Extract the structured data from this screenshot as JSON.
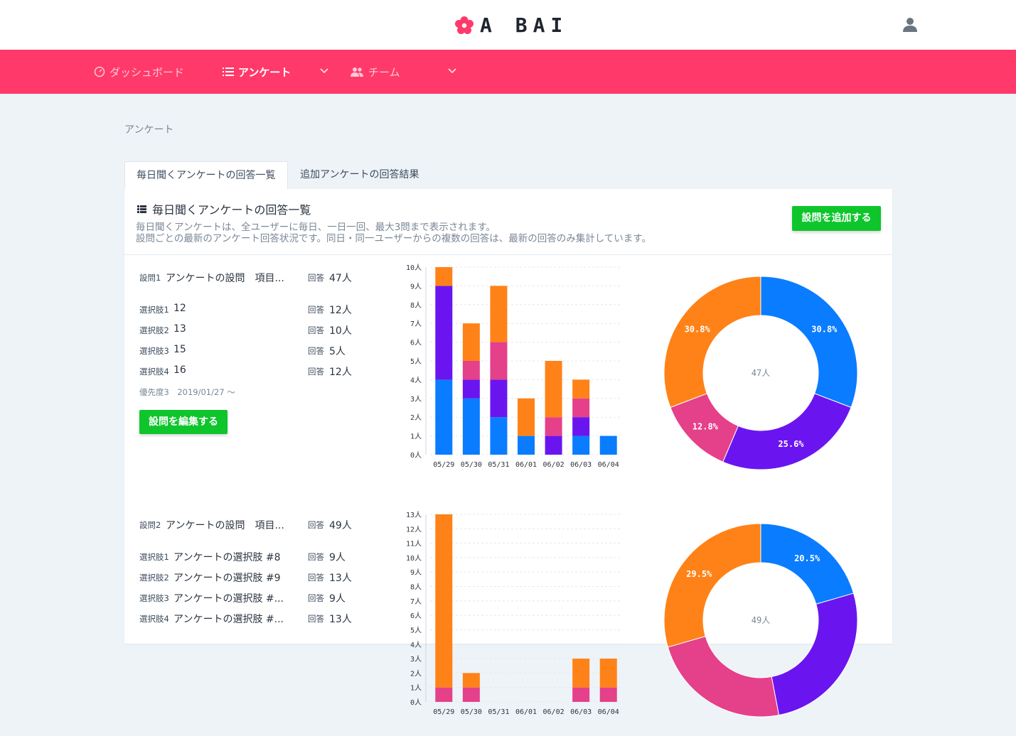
{
  "header": {
    "logo_text": "A BAI",
    "brand_color": "#ff3a6b"
  },
  "nav": {
    "dashboard": "ダッシュボード",
    "survey": "アンケート",
    "team": "チーム"
  },
  "breadcrumb": "アンケート",
  "tabs": [
    "毎日聞くアンケートの回答一覧",
    "追加アンケートの回答結果"
  ],
  "card": {
    "title": "毎日聞くアンケートの回答一覧",
    "desc1": "毎日聞くアンケートは、全ユーザーに毎日、一日一回、最大3問まで表示されます。",
    "desc2": "設問ごとの最新のアンケート回答状況です。同日・同一ユーザーからの複数の回答は、最新の回答のみ集計しています。",
    "add_button": "設問を追加する"
  },
  "labels": {
    "answer": "回答",
    "edit_button": "設問を編集する"
  },
  "colors": {
    "choice1": "#0a7cff",
    "choice2": "#6a15f0",
    "choice3": "#e5408a",
    "choice4": "#ff8218",
    "green": "#0ec52c"
  },
  "questions": [
    {
      "label": "設問1",
      "text": "アンケートの設問　項目...",
      "total": "47人",
      "choices": [
        {
          "label": "選択肢1",
          "text": "12",
          "count": "12人"
        },
        {
          "label": "選択肢2",
          "text": "13",
          "count": "10人"
        },
        {
          "label": "選択肢3",
          "text": "15",
          "count": "5人"
        },
        {
          "label": "選択肢4",
          "text": "16",
          "count": "12人"
        }
      ],
      "priority": "優先度3　2019/01/27 ～"
    },
    {
      "label": "設問2",
      "text": "アンケートの設問　項目...",
      "total": "49人",
      "choices": [
        {
          "label": "選択肢1",
          "text": "アンケートの選択肢 #8",
          "count": "9人"
        },
        {
          "label": "選択肢2",
          "text": "アンケートの選択肢 #9",
          "count": "13人"
        },
        {
          "label": "選択肢3",
          "text": "アンケートの選択肢 #...",
          "count": "9人"
        },
        {
          "label": "選択肢4",
          "text": "アンケートの選択肢 #...",
          "count": "13人"
        }
      ],
      "priority": ""
    }
  ],
  "chart_data": [
    {
      "type": "bar",
      "stacked": true,
      "categories": [
        "05/29",
        "05/30",
        "05/31",
        "06/01",
        "06/02",
        "06/03",
        "06/04"
      ],
      "y_unit": "人",
      "ylim": [
        0,
        10
      ],
      "series": [
        {
          "values": [
            4,
            3,
            2,
            1,
            0,
            1,
            1
          ]
        },
        {
          "values": [
            5,
            1,
            2,
            0,
            1,
            1,
            0
          ]
        },
        {
          "values": [
            0,
            1,
            2,
            0,
            1,
            1,
            0
          ]
        },
        {
          "values": [
            1,
            2,
            3,
            2,
            3,
            1,
            0
          ]
        }
      ],
      "grid": true
    },
    {
      "type": "pie",
      "donut": true,
      "center_label": "47人",
      "slices": [
        {
          "value": 30.8,
          "label": "30.8%"
        },
        {
          "value": 25.6,
          "label": "25.6%"
        },
        {
          "value": 12.8,
          "label": "12.8%"
        },
        {
          "value": 30.8,
          "label": "30.8%"
        }
      ]
    },
    {
      "type": "bar",
      "stacked": true,
      "categories": [
        "05/29",
        "05/30",
        "05/31",
        "06/01",
        "06/02",
        "06/03",
        "06/04"
      ],
      "y_unit": "人",
      "ylim": [
        0,
        13
      ],
      "series": [
        {
          "values": [
            0,
            0,
            0,
            0,
            0,
            0,
            0
          ]
        },
        {
          "values": [
            0,
            0,
            0,
            0,
            0,
            0,
            0
          ]
        },
        {
          "values": [
            1,
            1,
            0,
            0,
            0,
            1,
            1
          ]
        },
        {
          "values": [
            12,
            1,
            0,
            0,
            0,
            2,
            2
          ]
        }
      ],
      "grid": true
    },
    {
      "type": "pie",
      "donut": true,
      "center_label": "49人",
      "slices": [
        {
          "value": 20.5,
          "label": "20.5%"
        },
        {
          "value": 26.5,
          "label": ""
        },
        {
          "value": 23.5,
          "label": ""
        },
        {
          "value": 29.5,
          "label": "29.5%"
        }
      ]
    }
  ]
}
